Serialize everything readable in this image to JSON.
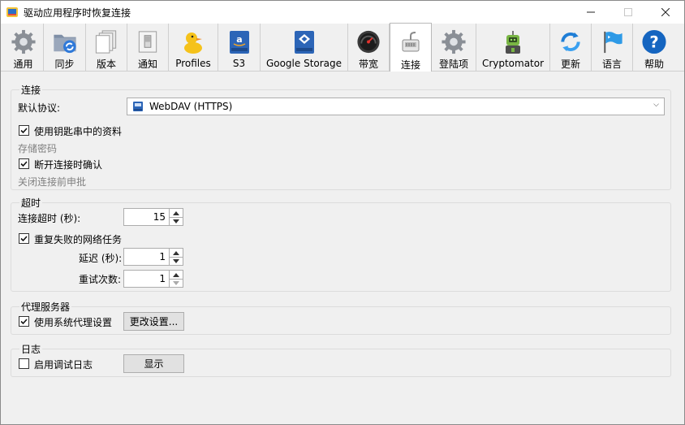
{
  "window": {
    "title": "驱动应用程序时恢复连接"
  },
  "tabs": [
    {
      "label": "通用",
      "icon": "gear-icon"
    },
    {
      "label": "同步",
      "icon": "sync-folder-icon"
    },
    {
      "label": "版本",
      "icon": "versions-icon"
    },
    {
      "label": "通知",
      "icon": "notification-switch-icon"
    },
    {
      "label": "Profiles",
      "icon": "profiles-duck-icon"
    },
    {
      "label": "S3",
      "icon": "s3-disk-icon"
    },
    {
      "label": "Google Storage",
      "icon": "google-storage-icon"
    },
    {
      "label": "带宽",
      "icon": "bandwidth-gauge-icon"
    },
    {
      "label": "连接",
      "icon": "connection-plug-icon"
    },
    {
      "label": "登陆项",
      "icon": "login-gear-icon"
    },
    {
      "label": "Cryptomator",
      "icon": "cryptomator-robot-icon"
    },
    {
      "label": "更新",
      "icon": "update-arrows-icon"
    },
    {
      "label": "语言",
      "icon": "language-flag-icon"
    },
    {
      "label": "帮助",
      "icon": "help-icon"
    }
  ],
  "active_tab": "连接",
  "connection": {
    "section_title": "连接",
    "default_protocol_label": "默认协议:",
    "default_protocol_value": "WebDAV (HTTPS)",
    "use_keychain_label": "使用钥匙串中的资料",
    "use_keychain_checked": true,
    "store_password_label": "存储密码",
    "confirm_disconnect_label": "断开连接时确认",
    "confirm_disconnect_checked": true,
    "confirm_disconnect_hint": "关闭连接前申批"
  },
  "timeout": {
    "section_title": "超时",
    "connection_timeout_label": "连接超时 (秒):",
    "connection_timeout_value": "15",
    "retry_failed_label": "重复失败的网络任务",
    "retry_failed_checked": true,
    "delay_label": "延迟 (秒):",
    "delay_value": "1",
    "retries_label": "重试次数:",
    "retries_value": "1"
  },
  "proxy": {
    "section_title": "代理服务器",
    "use_system_proxy_label": "使用系统代理设置",
    "use_system_proxy_checked": true,
    "change_settings_button": "更改设置..."
  },
  "log": {
    "section_title": "日志",
    "enable_debug_label": "启用调试日志",
    "enable_debug_checked": false,
    "show_button": "显示"
  }
}
